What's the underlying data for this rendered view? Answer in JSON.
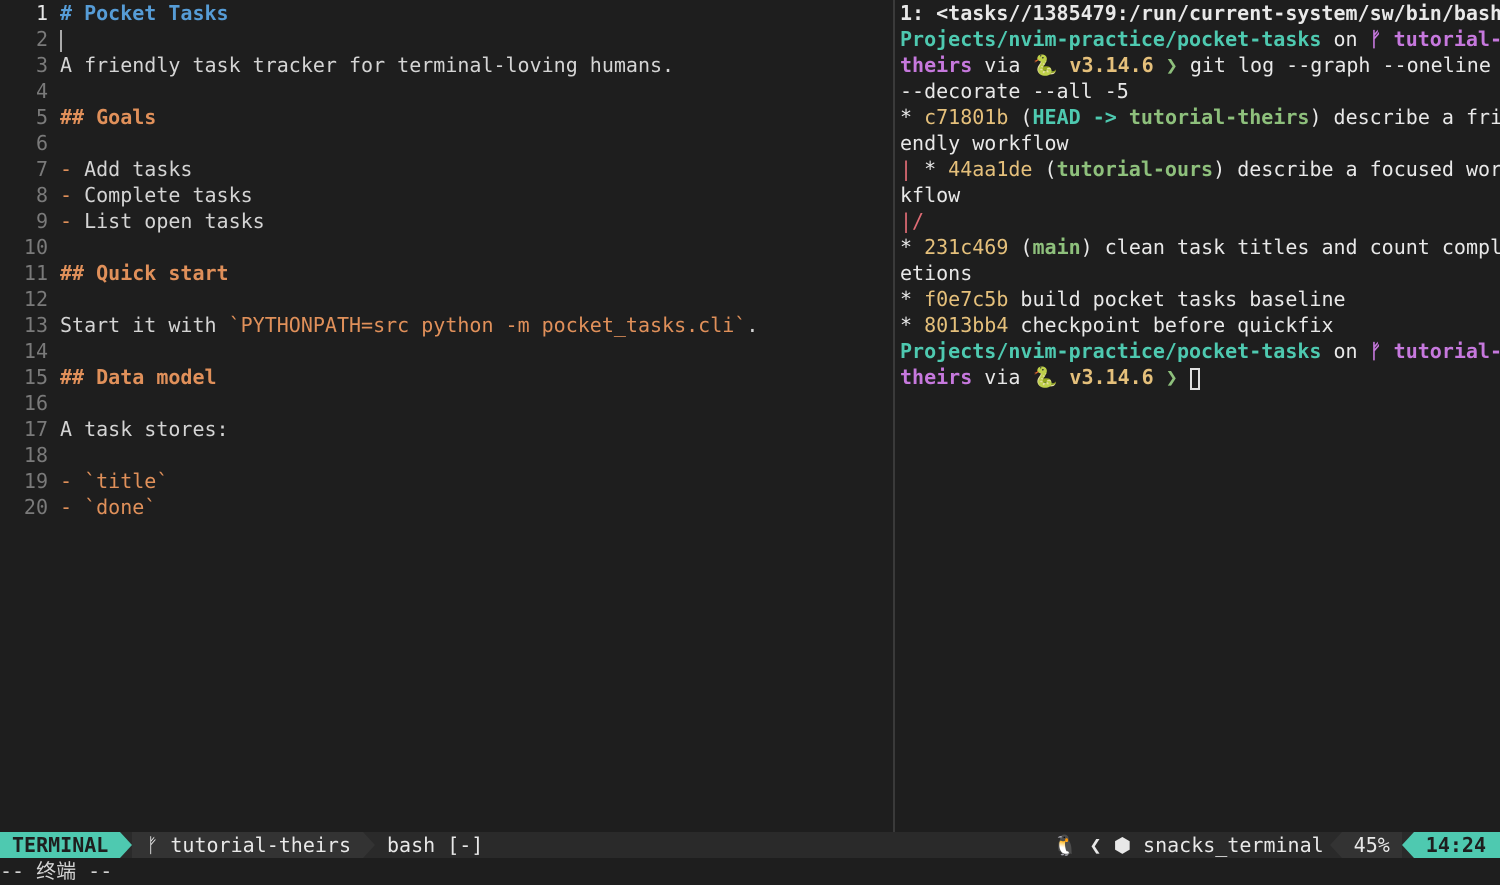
{
  "editor": {
    "lines": [
      {
        "n": "1",
        "parts": [
          {
            "t": "# Pocket Tasks",
            "c": "h1"
          }
        ]
      },
      {
        "n": "2",
        "parts": []
      },
      {
        "n": "3",
        "parts": [
          {
            "t": "A friendly task tracker for terminal-loving humans.",
            "c": ""
          }
        ]
      },
      {
        "n": "4",
        "parts": []
      },
      {
        "n": "5",
        "parts": [
          {
            "t": "## Goals",
            "c": "h2"
          }
        ]
      },
      {
        "n": "6",
        "parts": []
      },
      {
        "n": "7",
        "parts": [
          {
            "t": "-",
            "c": "bullet"
          },
          {
            "t": " Add tasks",
            "c": ""
          }
        ]
      },
      {
        "n": "8",
        "parts": [
          {
            "t": "-",
            "c": "bullet"
          },
          {
            "t": " Complete tasks",
            "c": ""
          }
        ]
      },
      {
        "n": "9",
        "parts": [
          {
            "t": "-",
            "c": "bullet"
          },
          {
            "t": " List open tasks",
            "c": ""
          }
        ]
      },
      {
        "n": "10",
        "parts": []
      },
      {
        "n": "11",
        "parts": [
          {
            "t": "## Quick start",
            "c": "h2"
          }
        ]
      },
      {
        "n": "12",
        "parts": []
      },
      {
        "n": "13",
        "parts": [
          {
            "t": "Start it with ",
            "c": ""
          },
          {
            "t": "`PYTHONPATH=src python -m pocket_tasks.cli`",
            "c": "code"
          },
          {
            "t": ".",
            "c": ""
          }
        ]
      },
      {
        "n": "14",
        "parts": []
      },
      {
        "n": "15",
        "parts": [
          {
            "t": "## Data model",
            "c": "h2"
          }
        ]
      },
      {
        "n": "16",
        "parts": []
      },
      {
        "n": "17",
        "parts": [
          {
            "t": "A task stores:",
            "c": ""
          }
        ]
      },
      {
        "n": "18",
        "parts": []
      },
      {
        "n": "19",
        "parts": [
          {
            "t": "-",
            "c": "bullet"
          },
          {
            "t": " ",
            "c": ""
          },
          {
            "t": "`title`",
            "c": "code"
          }
        ]
      },
      {
        "n": "20",
        "parts": [
          {
            "t": "-",
            "c": "bullet"
          },
          {
            "t": " ",
            "c": ""
          },
          {
            "t": "`done`",
            "c": "code"
          }
        ]
      }
    ]
  },
  "terminal": {
    "lines": [
      [
        {
          "t": "1: <tasks//1385479:/run/current-system/sw/bin/bash",
          "c": "white bold"
        }
      ],
      [
        {
          "t": "Projects/nvim-practice/pocket-tasks",
          "c": "cyan bold"
        },
        {
          "t": " on ",
          "c": "white"
        },
        {
          "t": "ᚠ tutorial-",
          "c": "magenta bold"
        }
      ],
      [
        {
          "t": "theirs",
          "c": "magenta bold"
        },
        {
          "t": " via ",
          "c": "white"
        },
        {
          "t": "🐍 v3.14.6",
          "c": "yellow bold"
        },
        {
          "t": " ❯ ",
          "c": "green bold"
        },
        {
          "t": "git log --graph --oneline",
          "c": "white"
        }
      ],
      [
        {
          "t": "--decorate --all -5",
          "c": "white"
        }
      ],
      [
        {
          "t": "* ",
          "c": "white"
        },
        {
          "t": "c71801b",
          "c": "yellow"
        },
        {
          "t": " (",
          "c": "white"
        },
        {
          "t": "HEAD ->",
          "c": "cyan bold"
        },
        {
          "t": " ",
          "c": "white"
        },
        {
          "t": "tutorial-theirs",
          "c": "green bold"
        },
        {
          "t": ") describe a fri",
          "c": "white"
        }
      ],
      [
        {
          "t": "endly workflow",
          "c": "white"
        }
      ],
      [
        {
          "t": "|",
          "c": "red"
        },
        {
          "t": " * ",
          "c": "white"
        },
        {
          "t": "44aa1de",
          "c": "yellow"
        },
        {
          "t": " (",
          "c": "white"
        },
        {
          "t": "tutorial-ours",
          "c": "green bold"
        },
        {
          "t": ") describe a focused wor",
          "c": "white"
        }
      ],
      [
        {
          "t": "kflow",
          "c": "white"
        }
      ],
      [
        {
          "t": "|/",
          "c": "red"
        }
      ],
      [
        {
          "t": "* ",
          "c": "white"
        },
        {
          "t": "231c469",
          "c": "yellow"
        },
        {
          "t": " (",
          "c": "white"
        },
        {
          "t": "main",
          "c": "green bold"
        },
        {
          "t": ") clean task titles and count compl",
          "c": "white"
        }
      ],
      [
        {
          "t": "etions",
          "c": "white"
        }
      ],
      [
        {
          "t": "* ",
          "c": "white"
        },
        {
          "t": "f0e7c5b",
          "c": "yellow"
        },
        {
          "t": " build pocket tasks baseline",
          "c": "white"
        }
      ],
      [
        {
          "t": "* ",
          "c": "white"
        },
        {
          "t": "8013bb4",
          "c": "yellow"
        },
        {
          "t": " checkpoint before quickfix",
          "c": "white"
        }
      ],
      [
        {
          "t": "Projects/nvim-practice/pocket-tasks",
          "c": "cyan bold"
        },
        {
          "t": " on ",
          "c": "white"
        },
        {
          "t": "ᚠ tutorial-",
          "c": "magenta bold"
        }
      ],
      [
        {
          "t": "theirs",
          "c": "magenta bold"
        },
        {
          "t": " via ",
          "c": "white"
        },
        {
          "t": "🐍 v3.14.6",
          "c": "yellow bold"
        },
        {
          "t": " ❯ ",
          "c": "green bold"
        }
      ]
    ]
  },
  "statusline": {
    "mode": "TERMINAL",
    "branch": "ᚠ tutorial-theirs",
    "file": "bash [-]",
    "os_icon": "🐧",
    "sep_icon": "❮",
    "ft_icon": "⬢",
    "filetype": "snacks_terminal",
    "percent": "45%",
    "time": "14:24"
  },
  "cmdline": "-- 终端 --"
}
